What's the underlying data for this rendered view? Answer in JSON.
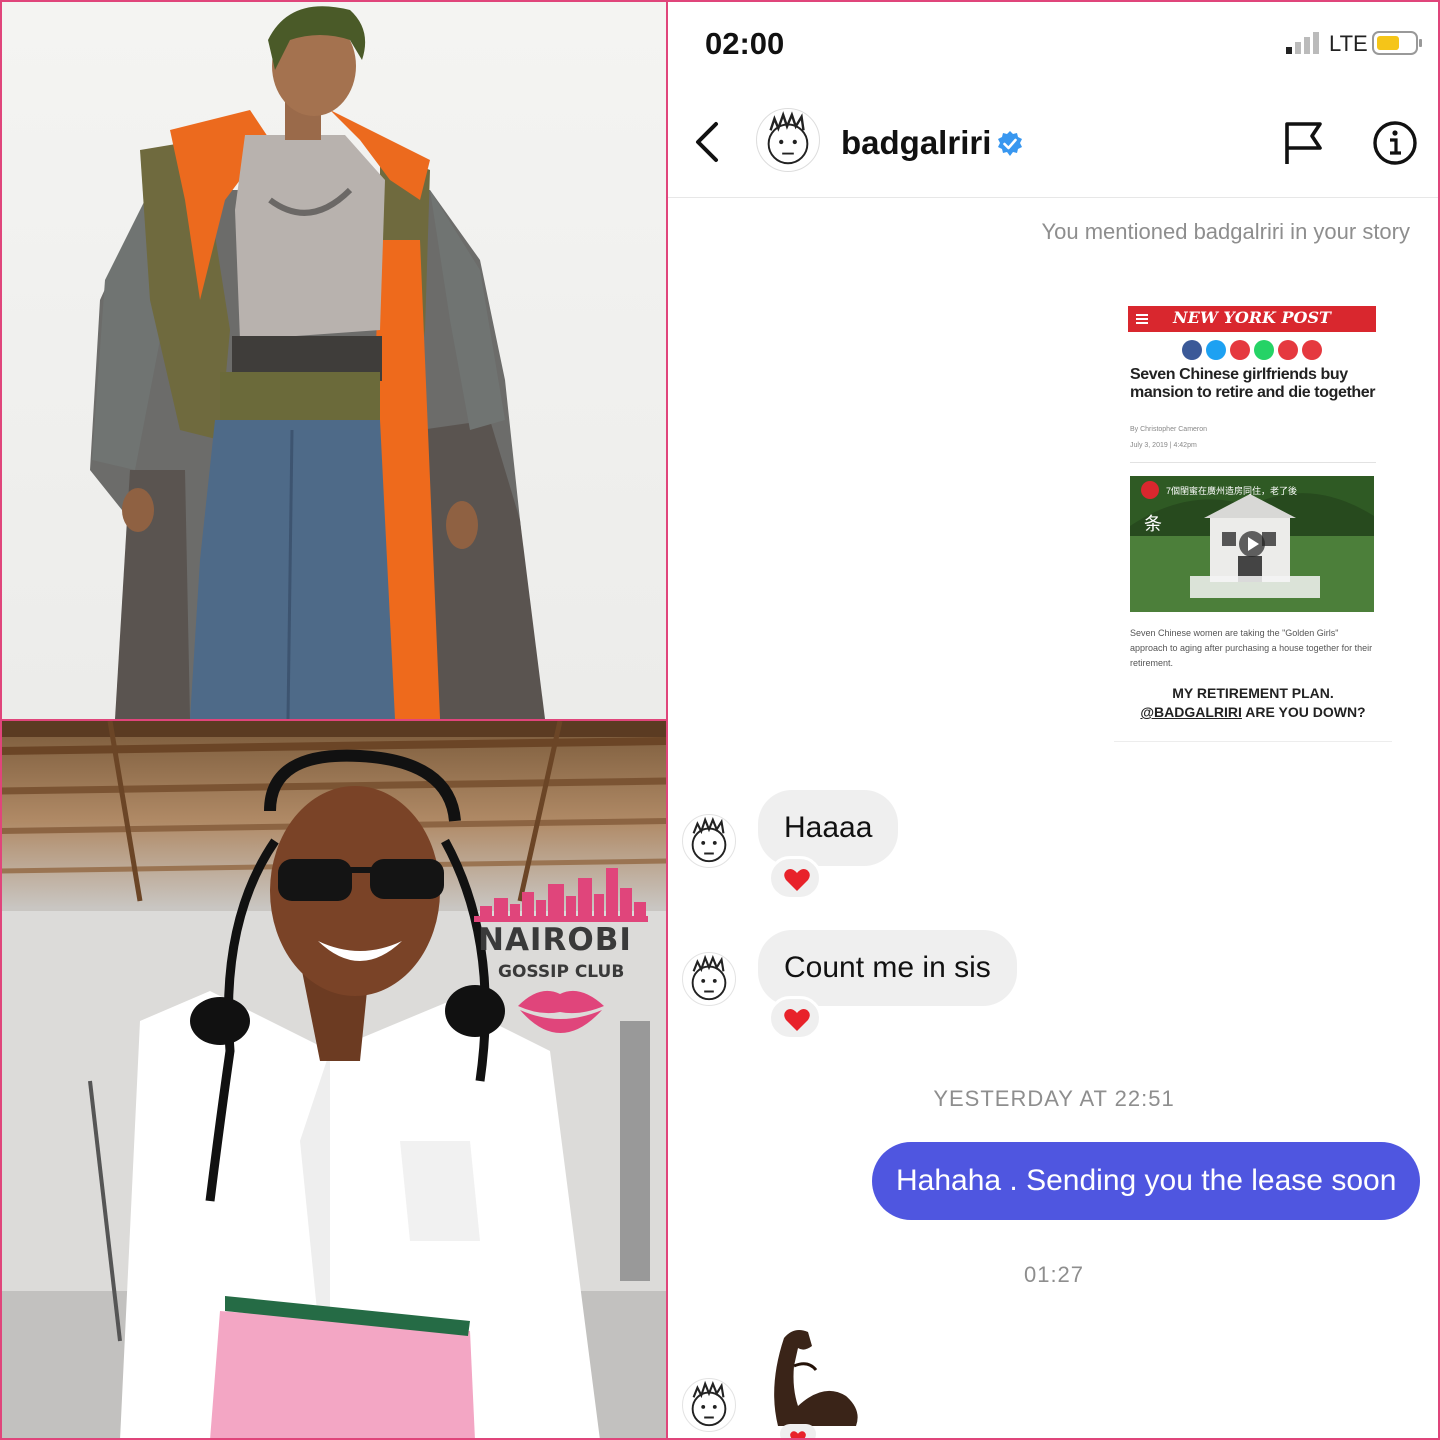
{
  "status_bar": {
    "time": "02:00",
    "network": "LTE",
    "battery_color": "#f5c518"
  },
  "header": {
    "username": "badgalriri",
    "verified_color": "#3897f0",
    "icons": [
      "back-icon",
      "flag-icon",
      "info-icon",
      "verified-badge-icon"
    ]
  },
  "story_mention": {
    "note": "You mentioned badgalriri in your story",
    "article": {
      "publication": "NEW YORK POST",
      "headline": "Seven Chinese girlfriends buy mansion to retire and die together",
      "byline": "By Christopher Cameron",
      "date": "July 3, 2019 | 4:42pm",
      "video_title": "7個閨蜜在廣州造房同住，老了後",
      "video_overlay": "条",
      "caption": "Seven Chinese women are taking the \"Golden Girls\" approach to aging after purchasing a house together for their retirement.",
      "comment_line1": "MY RETIREMENT PLAN.",
      "comment_mention": "@BADGALRIRI",
      "comment_line2": " ARE YOU DOWN?"
    }
  },
  "messages": [
    {
      "sender": "badgalriri",
      "text": "Haaaa",
      "reaction": "heart"
    },
    {
      "sender": "badgalriri",
      "text": "Count me in sis",
      "reaction": "heart"
    }
  ],
  "timestamps": {
    "first": "YESTERDAY AT 22:51",
    "second": "01:27"
  },
  "outgoing": {
    "text": "Hahaha . Sending you the lease soon",
    "color": "#4f56e0"
  },
  "last_message": {
    "sender": "badgalriri",
    "emoji": "flexed-biceps"
  },
  "watermark": {
    "title": "NAIROBI",
    "subtitle": "GOSSIP CLUB",
    "color": "#e0457b"
  },
  "colors": {
    "frame": "#e0457b",
    "bubble_in": "#efefef",
    "meta_text": "#8e8e8e"
  }
}
